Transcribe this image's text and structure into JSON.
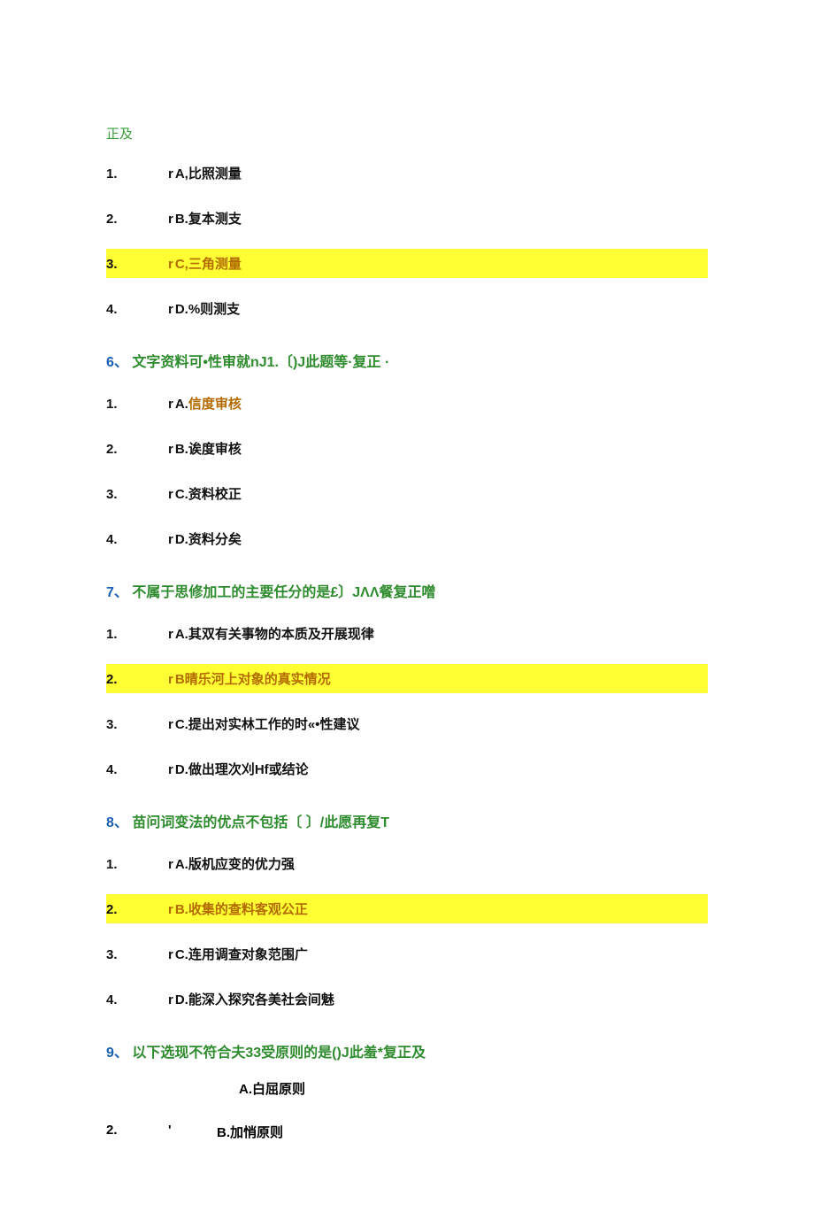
{
  "correction_top": "正及",
  "q5_options": [
    {
      "num": "1.",
      "prefix": "r",
      "letter": "A,",
      "text": "比照测量",
      "hl": false
    },
    {
      "num": "2.",
      "prefix": "r",
      "letter": "B.",
      "text": "复本测支",
      "hl": false
    },
    {
      "num": "3.",
      "prefix": "r",
      "letter": "C,",
      "text": "三角测量",
      "hl": true
    },
    {
      "num": "4.",
      "prefix": "r",
      "letter": "D.",
      "text": "%则测支",
      "hl": false
    }
  ],
  "q6": {
    "num": "6、",
    "text": "文字资料可•性审就nJ1.〔)J此题等·复正 ·"
  },
  "q6_options": [
    {
      "num": "1.",
      "prefix": "r",
      "letter": "A.",
      "text": "信度审核",
      "hl": false,
      "orange": true
    },
    {
      "num": "2.",
      "prefix": "r",
      "letter": "B.",
      "text": "诶度审核",
      "hl": false
    },
    {
      "num": "3.",
      "prefix": "r",
      "letter": "C.",
      "text": "资料校正",
      "hl": false
    },
    {
      "num": "4.",
      "prefix": "r",
      "letter": "D.",
      "text": "资料分矣",
      "hl": false
    }
  ],
  "q7": {
    "num": "7、",
    "text": "不属于思修加工的主要任分的是£〕JΛΛ餐复正噌"
  },
  "q7_options": [
    {
      "num": "1.",
      "prefix": "r",
      "letter": "A.",
      "text": "其双有关事物的本质及开展现律",
      "hl": false
    },
    {
      "num": "2.",
      "prefix": "r",
      "letter": "B",
      "text": "晴乐河上对象的真实情况",
      "hl": true
    },
    {
      "num": "3.",
      "prefix": "r",
      "letter": "C.",
      "text": "提出对实林工作的时«•性建议",
      "hl": false
    },
    {
      "num": "4.",
      "prefix": "r",
      "letter": "D.",
      "text": "做出理次刈Hf或结论",
      "hl": false
    }
  ],
  "q8": {
    "num": "8、",
    "text": "苗问词变法的优点不包括〔 〕/此愿再复T"
  },
  "q8_options": [
    {
      "num": "1.",
      "prefix": "r",
      "letter": "A.",
      "text": "版机应变的优力强",
      "hl": false
    },
    {
      "num": "2.",
      "prefix": "r",
      "letter": "B.",
      "text": "收集的查料客观公正",
      "hl": true
    },
    {
      "num": "3.",
      "prefix": "r",
      "letter": "C.",
      "text": "连用调查对象范围广",
      "hl": false
    },
    {
      "num": "4.",
      "prefix": "r",
      "letter": "D.",
      "text": "能深入探究各美社会间魅",
      "hl": false
    }
  ],
  "q9": {
    "num": "9、",
    "text": "以下选现不符合夫33受原则的是()J此羞*复正及"
  },
  "q9_row1": {
    "letter": "A.",
    "text": "白屈原则"
  },
  "q9_row2": {
    "num": "2.",
    "apos": "'",
    "letter": "B.",
    "text": "加悄原则"
  }
}
